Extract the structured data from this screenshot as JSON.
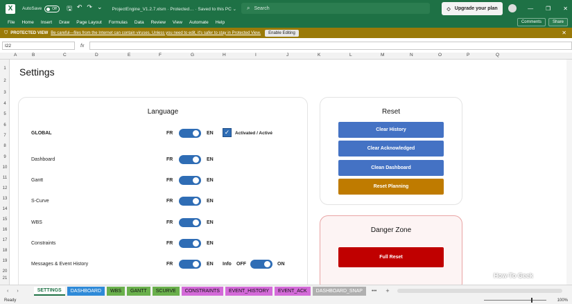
{
  "titlebar": {
    "app_icon": "excel-icon",
    "autosave_label": "AutoSave",
    "autosave_state": "Off",
    "filename": "ProjectEngine_V1.2.7.xlsm  ·  Protected…  ·  Saved to this PC ⌄",
    "search_placeholder": "Search",
    "upgrade_label": "Upgrade your plan"
  },
  "menu": {
    "items": [
      "File",
      "Home",
      "Insert",
      "Draw",
      "Page Layout",
      "Formulas",
      "Data",
      "Review",
      "View",
      "Automate",
      "Help"
    ],
    "comments": "Comments",
    "share": "Share"
  },
  "protected_view": {
    "label": "PROTECTED VIEW",
    "message": "Be careful—files from the Internet can contain viruses. Unless you need to edit, it's safer to stay in Protected View.",
    "button": "Enable Editing"
  },
  "formula_bar": {
    "name_box": "I22",
    "fx": "fx",
    "value": ""
  },
  "columns": [
    "A",
    "B",
    "C",
    "D",
    "E",
    "F",
    "G",
    "H",
    "I",
    "J",
    "K",
    "L",
    "M",
    "N",
    "O",
    "P",
    "Q"
  ],
  "rows": [
    "1",
    "2",
    "3",
    "4",
    "5",
    "6",
    "7",
    "8",
    "9",
    "10",
    "11",
    "12",
    "13",
    "14",
    "15",
    "16",
    "17",
    "18",
    "19",
    "20",
    "21",
    "22"
  ],
  "page_title": "Settings",
  "language": {
    "title": "Language",
    "global": {
      "label": "GLOBAL",
      "fr": "FR",
      "en": "EN",
      "check": "✓",
      "checkbox_label": "Activated / Activé"
    },
    "rows": [
      {
        "label": "Dashboard",
        "fr": "FR",
        "en": "EN"
      },
      {
        "label": "Gantt",
        "fr": "FR",
        "en": "EN"
      },
      {
        "label": "S-Curve",
        "fr": "FR",
        "en": "EN"
      },
      {
        "label": "WBS",
        "fr": "FR",
        "en": "EN"
      },
      {
        "label": "Constraints",
        "fr": "FR",
        "en": "EN"
      },
      {
        "label": "Messages & Event History",
        "fr": "FR",
        "en": "EN",
        "info": "Info",
        "off": "OFF",
        "on": "ON"
      }
    ]
  },
  "reset": {
    "title": "Reset",
    "buttons": [
      "Clear History",
      "Clear Acknowledged",
      "Clean Dashboard",
      "Reset Planning"
    ]
  },
  "danger": {
    "title": "Danger Zone",
    "button": "Full Reset"
  },
  "tabs": [
    {
      "label": "SETTINGS",
      "color": "#ffffff"
    },
    {
      "label": "DASHBOARD",
      "color": "#2f8ad8"
    },
    {
      "label": "WBS",
      "color": "#6ab04c"
    },
    {
      "label": "GANTT",
      "color": "#6ab04c"
    },
    {
      "label": "SCURVE",
      "color": "#6ab04c"
    },
    {
      "label": "CONSTRAINTS",
      "color": "#d36ad8"
    },
    {
      "label": "EVENT_HISTORY",
      "color": "#d36ad8"
    },
    {
      "label": "EVENT_ACK",
      "color": "#d36ad8"
    },
    {
      "label": "DASHBOARD_SNAP",
      "color": "#b0b0b0"
    }
  ],
  "status": {
    "ready": "Ready",
    "zoom": "100%"
  },
  "watermark": "How-To Geek"
}
